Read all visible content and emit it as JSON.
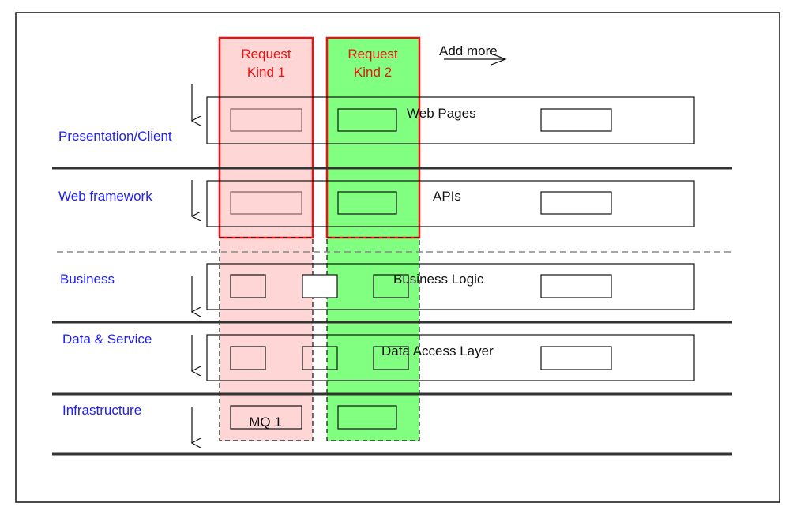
{
  "colors": {
    "kind1_fill": "#ffd6d6",
    "kind2_fill": "#80ff80",
    "column_border": "#ee1111",
    "layer_label": "#2020f0"
  },
  "columns": [
    {
      "title_line1": "Request",
      "title_line2": "Kind 1",
      "infra_box_label": "MQ 1"
    },
    {
      "title_line1": "Request",
      "title_line2": "Kind 2"
    }
  ],
  "add_more": "Add more",
  "layers": [
    {
      "label": "Presentation/Client",
      "component": "Web Pages"
    },
    {
      "label": "Web framework",
      "component": "APIs"
    },
    {
      "label": "Business",
      "component": "Business Logic"
    },
    {
      "label": "Data & Service",
      "component": "Data Access Layer"
    },
    {
      "label": "Infrastructure",
      "component": ""
    }
  ]
}
